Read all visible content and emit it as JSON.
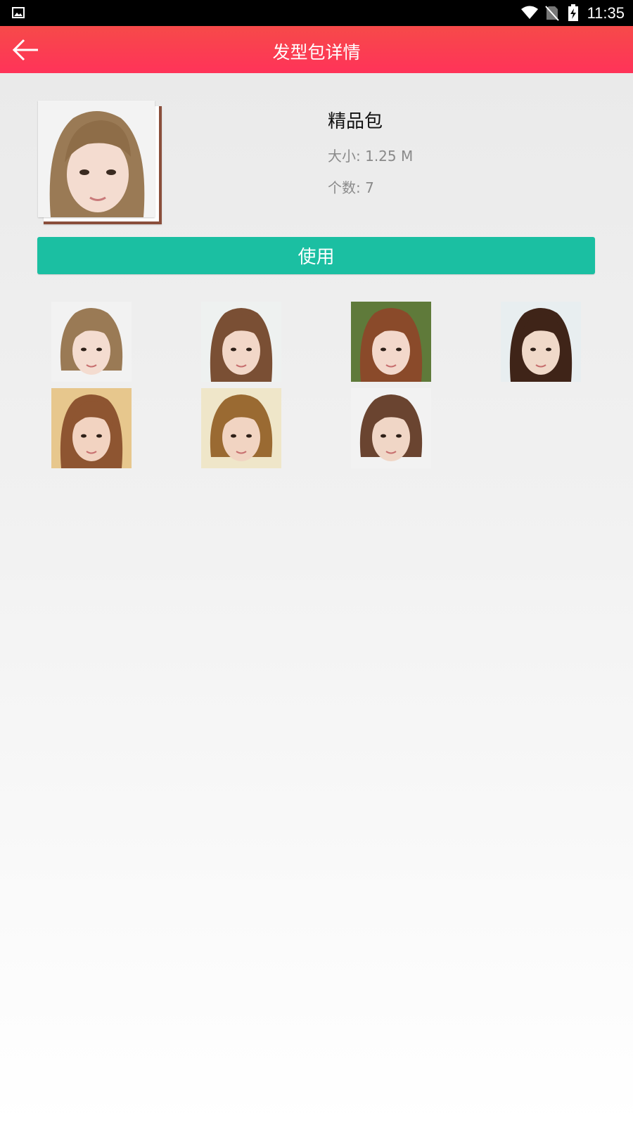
{
  "status_bar": {
    "time": "11:35",
    "icons": [
      "image-icon",
      "wifi-icon",
      "no-sim-icon",
      "battery-charging-icon"
    ]
  },
  "app_bar": {
    "title": "发型包详情",
    "back_icon": "arrow-left-icon"
  },
  "pack": {
    "name": "精品包",
    "size": "大小: 1.25 M",
    "count": "个数: 7"
  },
  "use_button": {
    "label": "使用"
  },
  "thumbnails": [
    {
      "style": "short-bob-light-brown",
      "hair": "#9a7a55",
      "bg": "#f2f2f2",
      "skin": "#f4dcd0"
    },
    {
      "style": "long-wavy-brown-bangs",
      "hair": "#7a4f34",
      "bg": "#eef1f0",
      "skin": "#f2d7c8"
    },
    {
      "style": "long-curly-auburn-headband",
      "hair": "#8a4a2a",
      "bg": "#5f7a3a",
      "skin": "#f3d8cb"
    },
    {
      "style": "long-wavy-dark-brown",
      "hair": "#3f2418",
      "bg": "#e8eef0",
      "skin": "#f0d9c9"
    },
    {
      "style": "long-curly-chestnut",
      "hair": "#8e5531",
      "bg": "#e7c78d",
      "skin": "#f2d3c1"
    },
    {
      "style": "bob-with-bangs-honey",
      "hair": "#9a6a32",
      "bg": "#efe6c9",
      "skin": "#f1d4c2"
    },
    {
      "style": "short-pixie-brown",
      "hair": "#6a4430",
      "bg": "#f2f2f2",
      "skin": "#f0d6c6"
    }
  ],
  "colors": {
    "app_bar": "#ff3e55",
    "accent": "#1bbfa2"
  }
}
